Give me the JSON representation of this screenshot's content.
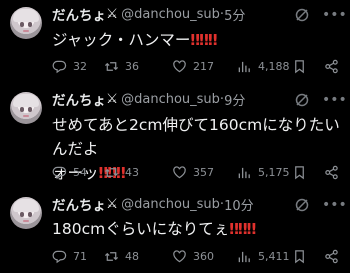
{
  "tweets": [
    {
      "name": "だんちょ",
      "name_mark": "⚔",
      "handle": "@danchou_sub",
      "separator": "·",
      "time": "5分",
      "text_lines": [
        "ジャック・ハンマー"
      ],
      "exclaim": "‼‼‼",
      "replies": "32",
      "retweets": "36",
      "likes": "217",
      "views": "4,188"
    },
    {
      "name": "だんちょ",
      "name_mark": "⚔",
      "handle": "@danchou_sub",
      "separator": "·",
      "time": "9分",
      "text_lines": [
        "せめてあと2cm伸びて160cmになりたいんだよ",
        "ォーッ"
      ],
      "exclaim": "‼‼‼",
      "replies": "54",
      "retweets": "43",
      "likes": "357",
      "views": "5,175"
    },
    {
      "name": "だんちょ",
      "name_mark": "⚔",
      "handle": "@danchou_sub",
      "separator": "·",
      "time": "10分",
      "text_lines": [
        "180cmぐらいになりてぇ"
      ],
      "exclaim": "‼‼‼",
      "replies": "71",
      "retweets": "48",
      "likes": "360",
      "views": "5,411"
    }
  ],
  "icons": {
    "more": "more-icon",
    "grok": "grok-icon",
    "reply": "reply-icon",
    "retweet": "retweet-icon",
    "like": "heart-icon",
    "views": "views-icon",
    "bookmark": "bookmark-icon",
    "share": "share-icon"
  },
  "colors": {
    "background": "#000000",
    "text": "#e7e9ea",
    "secondary": "#9a9ea3",
    "exclaim": "#e0312d"
  }
}
